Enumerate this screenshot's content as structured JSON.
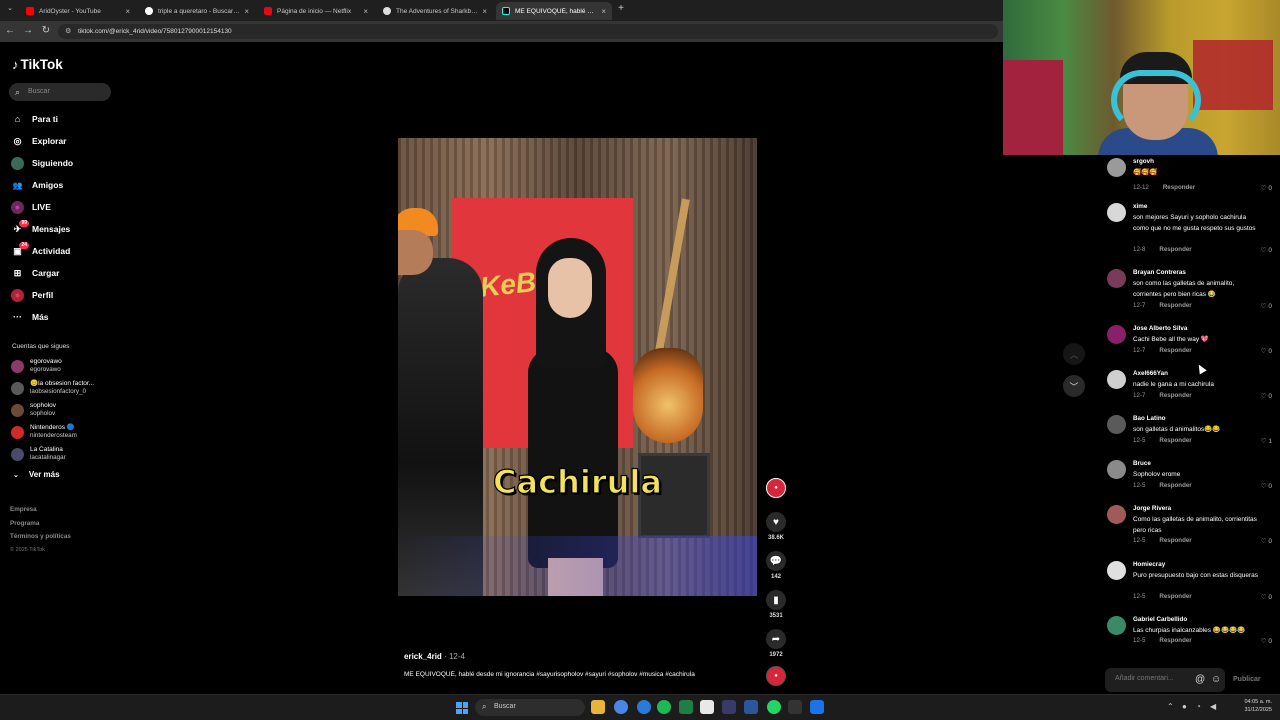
{
  "browser": {
    "tabs": [
      {
        "title": "AridOyster - YouTube",
        "favicon_color": "#ff0000",
        "active": false
      },
      {
        "title": "triple a queretaro - Buscar con Google",
        "favicon_color": "#ffffff",
        "active": false
      },
      {
        "title": "Página de inicio — Netflix",
        "favicon_color": "#e50914",
        "active": false
      },
      {
        "title": "The Adventures of Sharkboy and Lavagirl",
        "favicon_color": "#dddddd",
        "active": false
      },
      {
        "title": "ME EQUIVOQUÉ, hablé desde mi ignorancia",
        "favicon_color": "#000000",
        "active": true
      }
    ],
    "close_glyph": "×",
    "new_tab_glyph": "+",
    "url": "tiktok.com/@erick_4rid/video/7580127900012154130"
  },
  "sidebar": {
    "logo": "TikTok",
    "search_placeholder": "Buscar",
    "nav": [
      {
        "label": "Para ti",
        "icon": "home-icon",
        "glyph": "⌂"
      },
      {
        "label": "Explorar",
        "icon": "compass-icon",
        "glyph": "◎"
      },
      {
        "label": "Siguiendo",
        "icon": "following-icon",
        "glyph": "●"
      },
      {
        "label": "Amigos",
        "icon": "friends-icon",
        "glyph": "👥"
      },
      {
        "label": "LIVE",
        "icon": "live-icon",
        "glyph": "●"
      },
      {
        "label": "Mensajes",
        "icon": "messages-icon",
        "glyph": "✈",
        "badge": "99"
      },
      {
        "label": "Actividad",
        "icon": "activity-icon",
        "glyph": "▣",
        "badge": "24"
      },
      {
        "label": "Cargar",
        "icon": "upload-icon",
        "glyph": "⊞"
      },
      {
        "label": "Perfil",
        "icon": "profile-icon",
        "glyph": "●"
      },
      {
        "label": "Más",
        "icon": "more-icon",
        "glyph": "···"
      }
    ],
    "following_title": "Cuentas que sigues",
    "following": [
      {
        "name": "egorovawo",
        "handle": "egorovawo",
        "color": "#8a3b6a"
      },
      {
        "name": "😊la obsesion factor...",
        "handle": "laobsesionfactory_0",
        "color": "#5a5a5a"
      },
      {
        "name": "sopholov",
        "handle": "sopholov",
        "color": "#6b4a3a"
      },
      {
        "name": "Nintenderos 🔵",
        "handle": "nintenderosteam",
        "color": "#d02a2a"
      },
      {
        "name": "La Catalina",
        "handle": "lacatalinagar",
        "color": "#4a4a6a"
      }
    ],
    "ver_mas": "Ver más",
    "footer": [
      "Empresa",
      "Programa",
      "Términos y políticas"
    ],
    "copyright": "© 2025 TikTok"
  },
  "video": {
    "poster_text": "KeBu",
    "caption": "Cachirula",
    "author": "erick_4rid",
    "date": "12-4",
    "description": "ME EQUIVOQUÉ, hablé desde mi ignorancia #sayurisopholov #sayuri #sopholov #musica #cachirula"
  },
  "actions": {
    "likes": "38.6K",
    "comments": "142",
    "saves": "3531",
    "shares": "1972"
  },
  "comments": [
    {
      "user": "srgovh",
      "text": "🥰🥰🥰",
      "date": "12-12",
      "likes": "0",
      "color": "#9a9a9a"
    },
    {
      "user": "xime",
      "text": "son mejores Sayuri y sopholo cachirula como que no me gusta respeto sus gustos",
      "date": "12-8",
      "likes": "0",
      "color": "#d8d8d8"
    },
    {
      "user": "Brayan Contreras",
      "text": "son como las galletas de animalito, corrientes pero bien ricas 😂",
      "date": "12-7",
      "likes": "0",
      "color": "#7a3a5a"
    },
    {
      "user": "Jose Alberto Silva",
      "text": "Cachi Bebe all the way 💖",
      "date": "12-7",
      "likes": "0",
      "color": "#8a1f6a"
    },
    {
      "user": "Axel666Yan",
      "text": "nadie le gana a mi cachirula",
      "date": "12-7",
      "likes": "0",
      "color": "#cfcfcf"
    },
    {
      "user": "Bao Latino",
      "text": "son galletas d animalitos😂😂",
      "date": "12-5",
      "likes": "1",
      "color": "#5a5a5a"
    },
    {
      "user": "Bruce",
      "text": "Sopholov erome",
      "date": "12-5",
      "likes": "0",
      "color": "#8a8a8a"
    },
    {
      "user": "Jorge Rivera",
      "text": "Como las galletas de animalito, corrientitas pero ricas",
      "date": "12-5",
      "likes": "0",
      "color": "#a05a5a"
    },
    {
      "user": "Homiecray",
      "text": "Puro presupuesto bajo con estas disqueras",
      "date": "12-5",
      "likes": "0",
      "color": "#e0e0e0"
    },
    {
      "user": "Gabriel Carbellido",
      "text": "Las churpias inalcanzables 😂😂😂😂",
      "date": "12-5",
      "likes": "0",
      "color": "#3a8a6a"
    }
  ],
  "reply_label": "Responder",
  "add_comment": {
    "placeholder": "Añadir comentari...",
    "publish": "Publicar"
  },
  "taskbar": {
    "search": "Buscar",
    "time": "04:05 a. m.",
    "date": "31/12/2025"
  }
}
